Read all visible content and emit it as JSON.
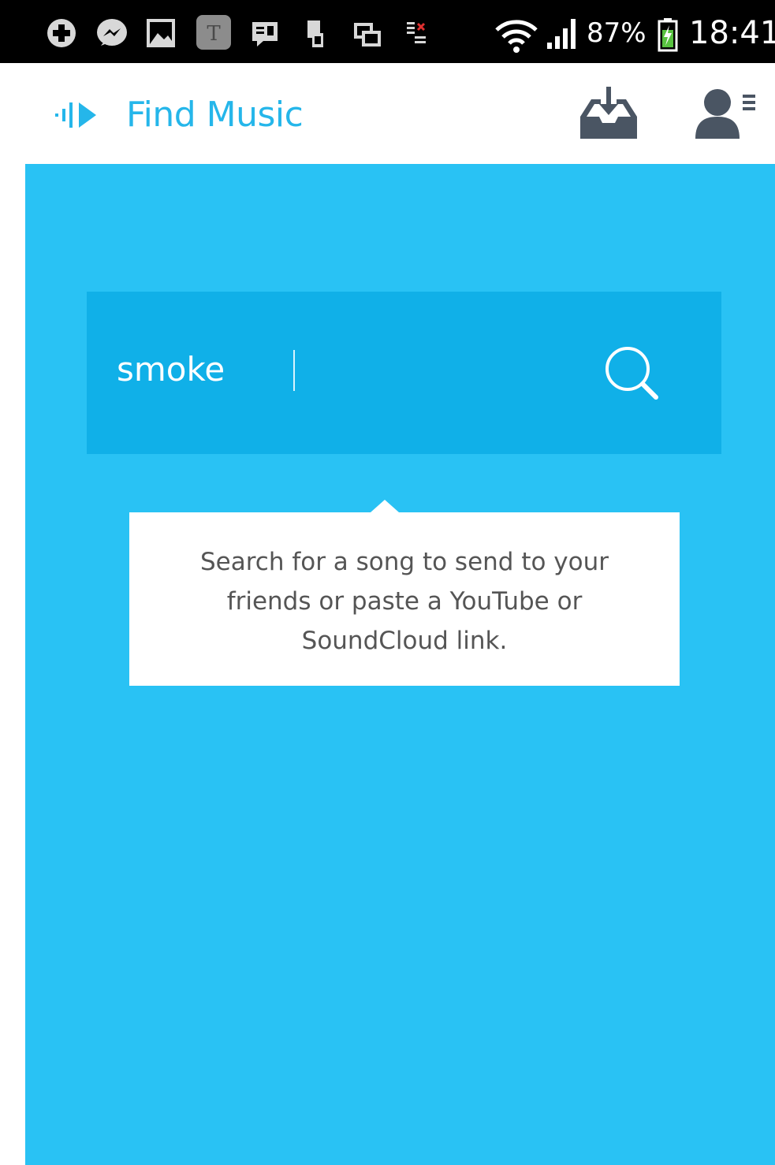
{
  "status_bar": {
    "icons": [
      "plus-circle-icon",
      "messenger-icon",
      "gallery-icon",
      "t-app-icon",
      "chat-icon",
      "phone-sd-icon",
      "window-icon",
      "data-transfer-icon",
      "wifi-icon",
      "signal-icon",
      "battery-charging-icon"
    ],
    "battery_percent": "87%",
    "time": "18:41"
  },
  "header": {
    "title": "Find Music",
    "logo_icon": "soundwave-play-icon",
    "inbox_icon": "inbox-download-icon",
    "profile_icon": "user-menu-icon"
  },
  "search": {
    "value": "smoke",
    "icon": "search-icon"
  },
  "tooltip": {
    "text": "Search for a song to send to your friends or paste a YouTube or SoundCloud link."
  },
  "colors": {
    "accent": "#29c2f4",
    "search_bg": "#10b0e8",
    "title": "#25b6ea",
    "icon_gray": "#4a5563"
  }
}
